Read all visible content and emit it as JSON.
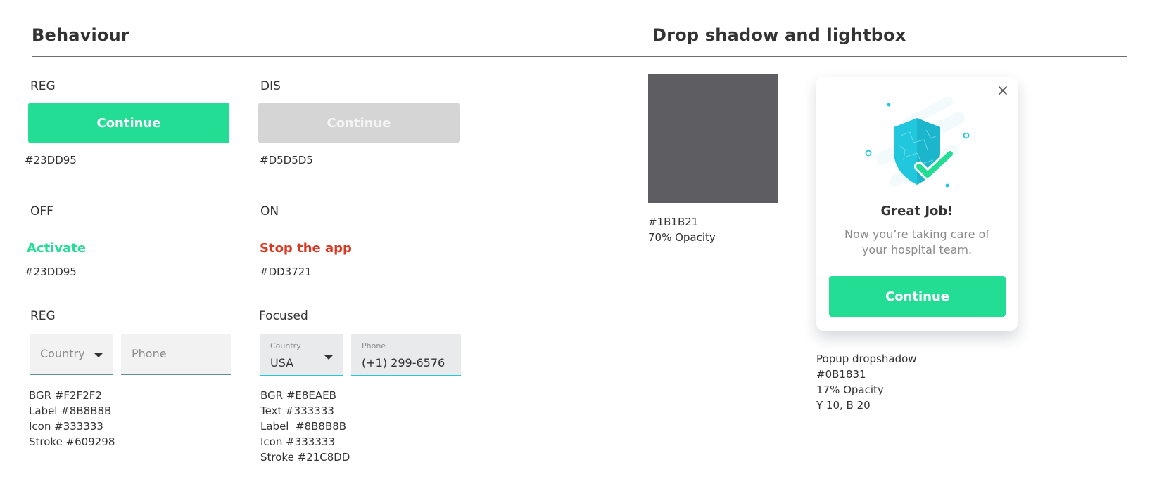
{
  "sections": {
    "behaviour_title": "Behaviour",
    "shadow_title": "Drop shadow and lightbox"
  },
  "buttons": {
    "reg_label": "REG",
    "reg_text": "Continue",
    "reg_hex": "#23DD95",
    "dis_label": "DIS",
    "dis_text": "Continue",
    "dis_hex": "#D5D5D5"
  },
  "toggles": {
    "off_label": "OFF",
    "off_text": "Activate",
    "off_hex": "#23DD95",
    "on_label": "ON",
    "on_text": "Stop the app",
    "on_hex": "#DD3721"
  },
  "inputs": {
    "reg_label": "REG",
    "reg_country_placeholder": "Country",
    "reg_phone_placeholder": "Phone",
    "reg_specs": [
      "BGR #F2F2F2",
      "Label #8B8B8B",
      "Icon #333333",
      "Stroke #609298"
    ],
    "focused_label": "Focused",
    "focused_country_label": "Country",
    "focused_country_value": "USA",
    "focused_phone_label": "Phone",
    "focused_phone_value": "(+1) 299-6576",
    "focused_specs": [
      "BGR #E8EAEB",
      "Text #333333",
      "Label  #8B8B8B",
      "Icon #333333",
      "Stroke #21C8DD"
    ]
  },
  "lightbox": {
    "hex": "#1B1B21",
    "opacity": "70% Opacity"
  },
  "popup": {
    "title": "Great Job!",
    "body_line1": "Now you’re taking care of",
    "body_line2": "your hospital team.",
    "button_text": "Continue",
    "close_icon": "×",
    "illustration": "shield-check-icon",
    "specs": [
      "Popup dropshadow",
      "#0B1831",
      "17% Opacity",
      "Y 10, B 20"
    ]
  },
  "colors": {
    "accent_green": "#23DD95",
    "disabled": "#D5D5D5",
    "danger": "#DD3721",
    "focus_stroke": "#21C8DD",
    "shield": "#21C8DD"
  }
}
